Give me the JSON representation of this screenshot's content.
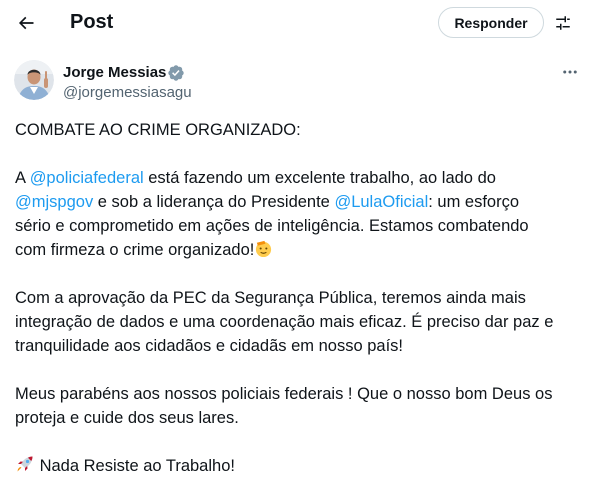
{
  "header": {
    "title": "Post",
    "reply_label": "Responder"
  },
  "author": {
    "name": "Jorge Messias",
    "handle": "@jorgemessiasagu"
  },
  "tweet": {
    "p1": "COMBATE AO CRIME ORGANIZADO:",
    "p2": {
      "l1_a": "A ",
      "l1_mention": "@policiafederal",
      "l1_b": " está fazendo um excelente trabalho, ao lado do",
      "l2_mention": "@mjspgov",
      "l2_b": " e sob a liderança do Presidente ",
      "l2_mention2": "@LulaOficial",
      "l2_c": ": um esforço",
      "l3": "sério e comprometido em ações de inteligência. Estamos combatendo",
      "l4": "com firmeza o crime organizado!"
    },
    "p3": {
      "l1": "Com a aprovação da PEC da Segurança Pública, teremos ainda mais",
      "l2": "integração de dados e uma coordenação mais eficaz. É preciso dar paz e",
      "l3": "tranquilidade aos cidadãos e cidadãs em nosso país!"
    },
    "p4": {
      "l1": "Meus parabéns aos nossos policiais federais ! Que o nosso bom Deus os",
      "l2": "proteja e cuide dos seus lares."
    },
    "p5": " Nada Resiste ao Trabalho!"
  },
  "icons": {
    "back": "arrow-left-icon",
    "settings": "sliders-icon",
    "verified": "verified-badge-icon",
    "more": "more-horizontal-icon",
    "salute_emoji": "saluting-face-emoji",
    "rocket_emoji": "rocket-emoji"
  },
  "colors": {
    "link": "#1d9bf0",
    "text": "#0f1419",
    "secondary": "#536471",
    "border": "#cfd9de"
  }
}
